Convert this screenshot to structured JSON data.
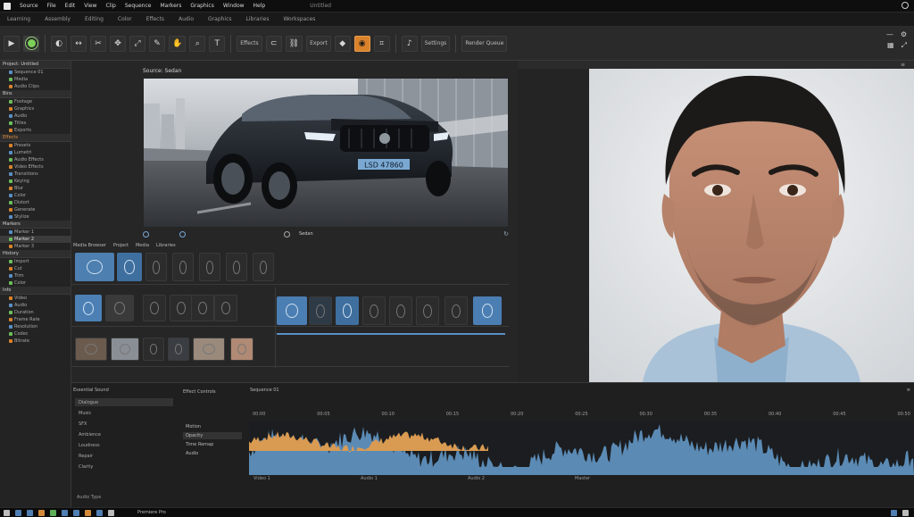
{
  "menubar": {
    "items": [
      "Source",
      "File",
      "Edit",
      "View",
      "Clip",
      "Sequence",
      "Markers",
      "Graphics",
      "Window",
      "Help"
    ],
    "title": "Untitled"
  },
  "tabbar": {
    "items": [
      "Learning",
      "Assembly",
      "Editing",
      "Color",
      "Effects",
      "Audio",
      "Graphics",
      "Libraries",
      "Workspaces"
    ]
  },
  "toolbar": {
    "tools": [
      {
        "glyph": "◐",
        "name": "record-icon"
      },
      {
        "glyph": "↔",
        "name": "ripple-icon"
      },
      {
        "glyph": "✂",
        "name": "razor-icon"
      },
      {
        "glyph": "✥",
        "name": "move-icon"
      },
      {
        "glyph": "⤢",
        "name": "slip-icon"
      },
      {
        "glyph": "✎",
        "name": "pen-icon"
      },
      {
        "glyph": "✋",
        "name": "hand-icon"
      },
      {
        "glyph": "⌕",
        "name": "zoom-icon"
      },
      {
        "glyph": "T",
        "name": "type-icon"
      }
    ],
    "label_effects": "Effects",
    "label_export": "Export",
    "label_settings": "Settings",
    "label_render": "Render Queue"
  },
  "left_panel": {
    "sections": [
      {
        "title": "Project: Untitled",
        "tone": "normal",
        "items": [
          "Sequence 01",
          "Media",
          "Audio Clips"
        ]
      },
      {
        "title": "Bins",
        "tone": "normal",
        "items": [
          "Footage",
          "Graphics",
          "Audio",
          "Titles",
          "Exports"
        ]
      },
      {
        "title": "Effects",
        "tone": "orange",
        "items": [
          "Presets",
          "Lumetri",
          "Audio Effects",
          "Video Effects",
          "Transitions",
          "Keying",
          "Blur",
          "Color",
          "Distort",
          "Generate",
          "Stylize"
        ]
      },
      {
        "title": "Markers",
        "tone": "normal",
        "items": [
          "Marker 1",
          "Marker 2",
          "Marker 3"
        ]
      },
      {
        "title": "History",
        "tone": "normal",
        "items": [
          "Import",
          "Cut",
          "Trim",
          "Color"
        ]
      },
      {
        "title": "Info",
        "tone": "normal",
        "items": [
          "Video",
          "Audio",
          "Duration",
          "Frame Rate",
          "Resolution",
          "Codec",
          "Bitrate"
        ]
      }
    ]
  },
  "preview": {
    "label": "Source: Sedan",
    "status_label": "Sedan",
    "plate": "LSD 47860"
  },
  "media_panel": {
    "header": "Media Browser",
    "tabs": [
      "Project",
      "Media",
      "Libraries"
    ]
  },
  "effects_panel": {
    "header": "Effect Controls",
    "items": [
      "Motion",
      "Opacity",
      "Time Remap",
      "Audio"
    ]
  },
  "timeline": {
    "header": "Sequence 01",
    "timecodes": [
      "00:00",
      "00:05",
      "00:10",
      "00:15",
      "00:20",
      "00:25",
      "00:30",
      "00:35",
      "00:40",
      "00:45",
      "00:50"
    ],
    "track_labels": [
      "Video 1",
      "Audio 1",
      "Audio 2",
      "Master"
    ]
  },
  "bottom_left": {
    "header": "Essential Sound",
    "rows": [
      "Dialogue",
      "Music",
      "SFX",
      "Ambience",
      "Loudness",
      "Repair",
      "Clarity"
    ],
    "footer": "Audio Type"
  },
  "taskbar": {
    "label": "Premiere Pro"
  },
  "colors": {
    "accent_orange": "#d9822b",
    "accent_blue": "#5a8fc4",
    "wave_blue": "#5b8bb5",
    "wave_orange": "#d99a52"
  }
}
